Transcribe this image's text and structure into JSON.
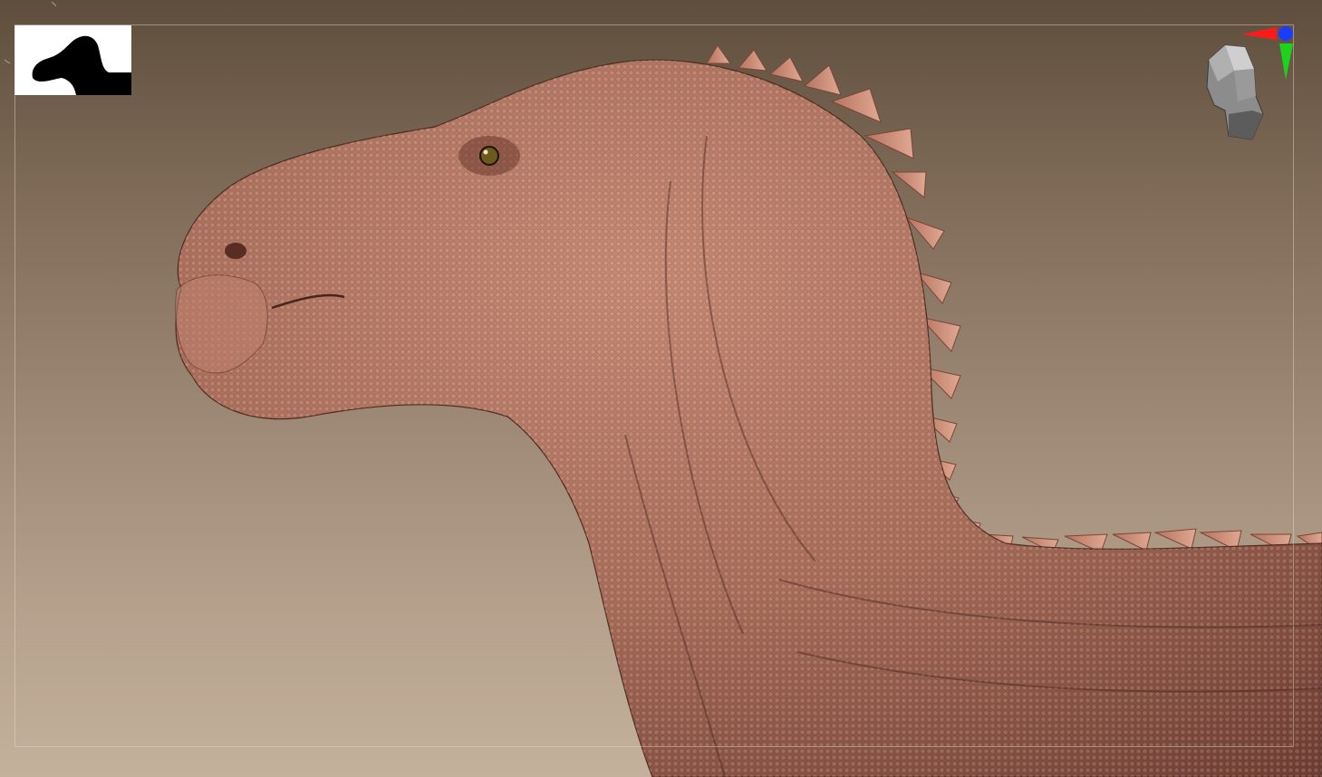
{
  "app": {
    "viewport": "sculpt-viewport",
    "model_subject": "dinosaur-head-and-neck-sculpt"
  },
  "colors": {
    "background_top": "#5f4e3d",
    "background_bottom": "#c4b19b",
    "skin_base": "#a86d5a",
    "skin_shadow": "#6e3e33",
    "spine_plate": "#c98b76",
    "axis_x": "#ff1a1a",
    "axis_y": "#1ad51a",
    "axis_z": "#1a3cff",
    "frame_line": "#e6dccd"
  },
  "icons": {
    "thumbnail": "silhouette-thumbnail-icon",
    "navigator": "head-navigator-icon",
    "axis_gizmo": "axis-gizmo-icon",
    "arc": "rotation-arc-icon"
  }
}
